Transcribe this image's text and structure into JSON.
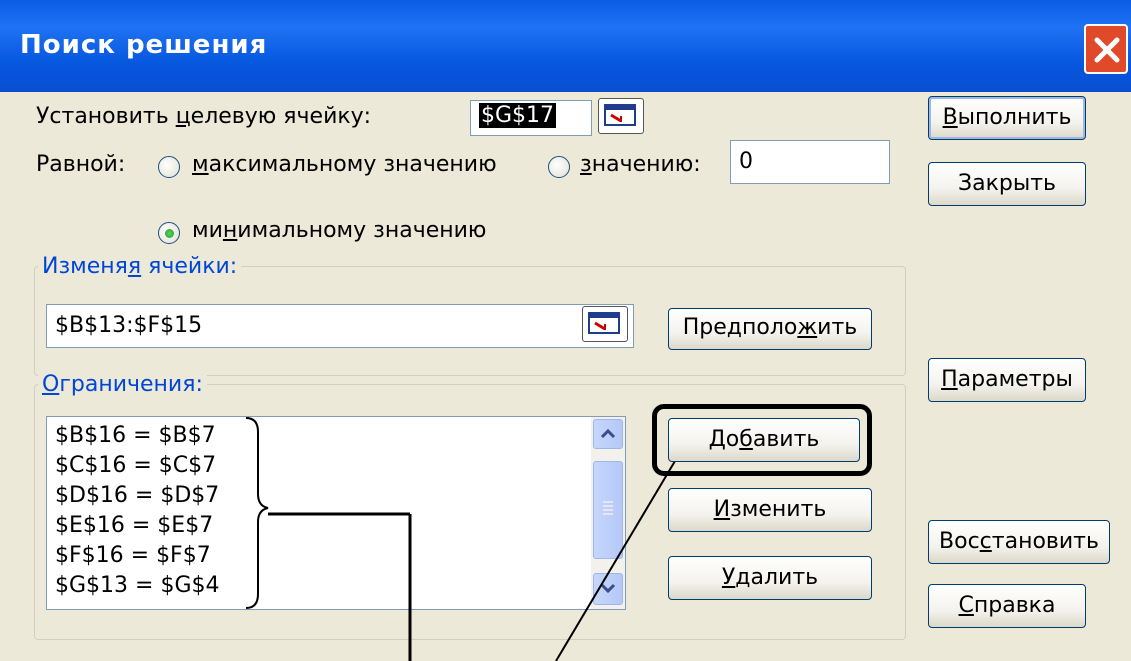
{
  "window": {
    "title": "Поиск решения",
    "close_icon": "close-icon"
  },
  "target": {
    "label_pre": "Установить ",
    "label_u": "ц",
    "label_post": "елевую ячейку:",
    "value": "$G$17"
  },
  "equal": {
    "label": "Равной:",
    "opt_max": {
      "u": "м",
      "rest": "аксимальному значению",
      "selected": false
    },
    "opt_value": {
      "u": "з",
      "rest": "начению:",
      "selected": false
    },
    "value_input": "0",
    "opt_min": {
      "pre": "ми",
      "u": "н",
      "rest": "имальному значению",
      "selected": true
    }
  },
  "changing": {
    "legend_pre": "Изменя",
    "legend_u": "я",
    "legend_post": " ячейки:",
    "value": "$B$13:$F$15"
  },
  "guess_button": {
    "pre": "Предполо",
    "u": "ж",
    "post": "ить"
  },
  "constraints": {
    "legend_u": "О",
    "legend_post": "граничения:",
    "items": [
      "$B$16 = $B$7",
      "$C$16 = $C$7",
      "$D$16 = $D$7",
      "$E$16 = $E$7",
      "$F$16 = $F$7",
      "$G$13 = $G$4"
    ]
  },
  "buttons": {
    "add": {
      "pre": "До",
      "u": "б",
      "post": "авить"
    },
    "change": {
      "pre": "",
      "u": "И",
      "post": "зменить"
    },
    "delete": {
      "pre": "",
      "u": "У",
      "post": "далить"
    },
    "solve": {
      "pre": "",
      "u": "В",
      "post": "ыполнить"
    },
    "close": {
      "label": "Закрыть"
    },
    "options": {
      "pre": "",
      "u": "П",
      "post": "араметры"
    },
    "reset": {
      "pre": "Вос",
      "u": "с",
      "post": "тановить"
    },
    "help": {
      "pre": "",
      "u": "С",
      "post": "правка"
    }
  }
}
